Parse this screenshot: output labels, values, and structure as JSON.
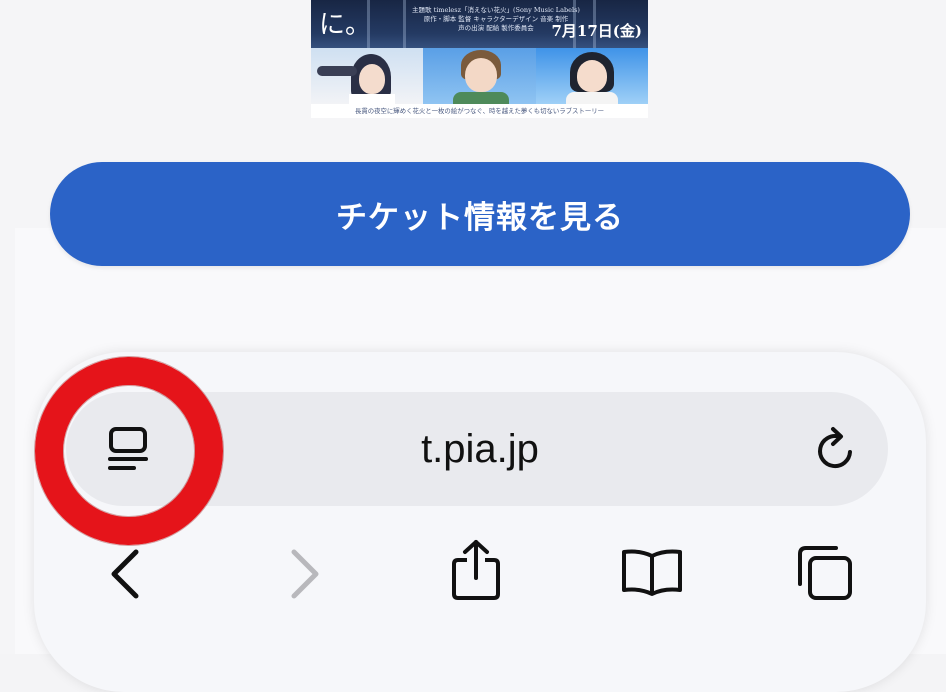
{
  "poster": {
    "big_text": "に。",
    "credits_line1": "主題歌 timelesz「消えない花火」(Sony Music Labels)",
    "credits_line2": "原作・脚本 監督 キャラクターデザイン 音楽 制作",
    "credits_line3": "声の出演 配給 製作委員会",
    "release_date": "7月17日(金)",
    "tagline": "長貫の夜空に輝めく花火と一枚の絵がつなぐ、時を越えた夢くも切ないラブストーリー"
  },
  "ticket_button": {
    "label": "チケット情報を見る",
    "color": "#2b63c7"
  },
  "address_bar": {
    "url": "t.pia.jp",
    "page_menu_icon": "page-menu-icon",
    "reload_icon": "reload-icon"
  },
  "toolbar": {
    "back_icon": "chevron-left-icon",
    "forward_icon": "chevron-right-icon",
    "forward_enabled": false,
    "share_icon": "share-icon",
    "bookmarks_icon": "book-icon",
    "tabs_icon": "tabs-icon"
  },
  "annotation": {
    "highlight_color": "#e5141a",
    "highlight_target": "page-menu-icon"
  }
}
